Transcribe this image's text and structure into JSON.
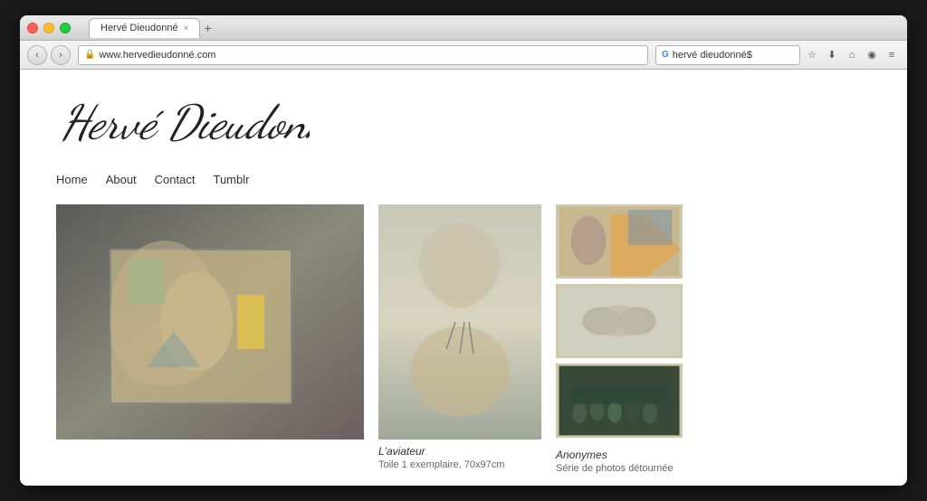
{
  "browser": {
    "tab_title": "Hervé Dieudonné",
    "tab_close": "×",
    "new_tab": "+",
    "back_arrow": "‹",
    "forward_arrow": "›",
    "url": "www.hervedieudonné.com",
    "search_placeholder": "hervé dieudonné$",
    "nav_icons": [
      "☆",
      "⬇",
      "⌂",
      "◉",
      "≡"
    ]
  },
  "site": {
    "logo": "Hervé Dieudonné",
    "logo_display": "Hervé Dieudonné",
    "nav": {
      "home": "Home",
      "about": "About",
      "contact": "Contact",
      "tumblr": "Tumblr"
    }
  },
  "gallery": {
    "item1": {
      "title": "",
      "description": ""
    },
    "item2": {
      "title": "L'aviateur",
      "description": "Toile 1 exemplaire, 70x97cm"
    },
    "item3": {
      "title": "Anonymes",
      "description": "Série de photos détournée"
    }
  }
}
